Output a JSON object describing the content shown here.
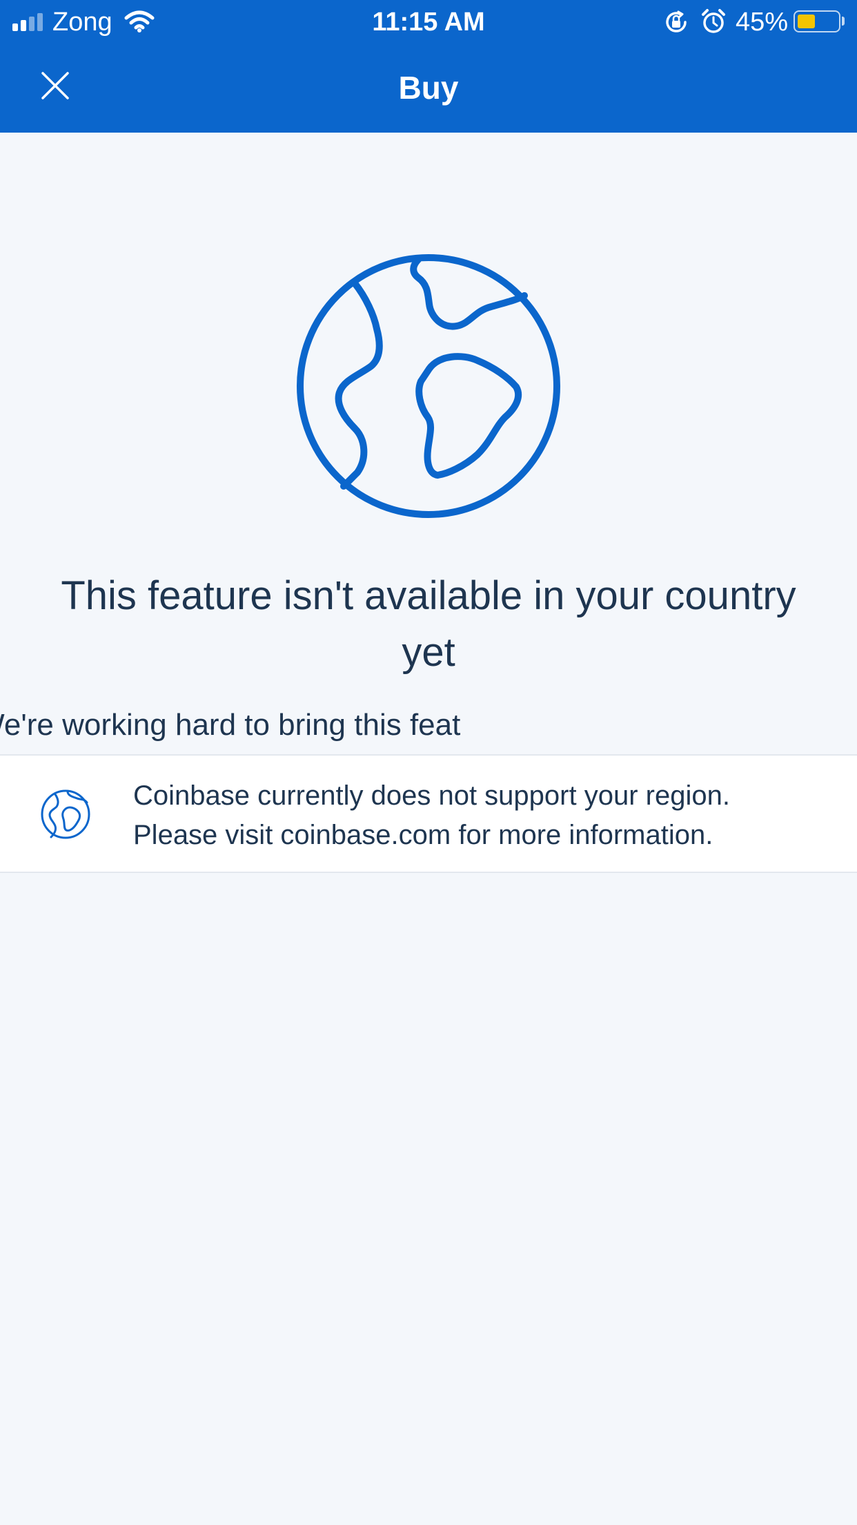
{
  "status_bar": {
    "carrier": "Zong",
    "time": "11:15 AM",
    "battery_percent_label": "45%",
    "battery_level": 0.45,
    "battery_color": "#f5c400",
    "icons": [
      "cellular-signal-icon",
      "wifi-icon",
      "orientation-lock-icon",
      "alarm-icon",
      "battery-icon"
    ]
  },
  "header": {
    "title": "Buy",
    "close_icon": "close-icon",
    "background_color": "#0b66cc"
  },
  "main": {
    "hero_icon": "globe-icon",
    "headline": "This feature isn't available in your country yet",
    "subtext": "ed in Hong Kong yet. We're working hard to bring this feat",
    "notice": {
      "icon": "globe-icon",
      "line1": "Coinbase currently does not support your region.",
      "line2": "Please visit coinbase.com for more information."
    }
  },
  "colors": {
    "accent": "#0b66cc",
    "text": "#1e3550",
    "background": "#f4f7fb"
  }
}
